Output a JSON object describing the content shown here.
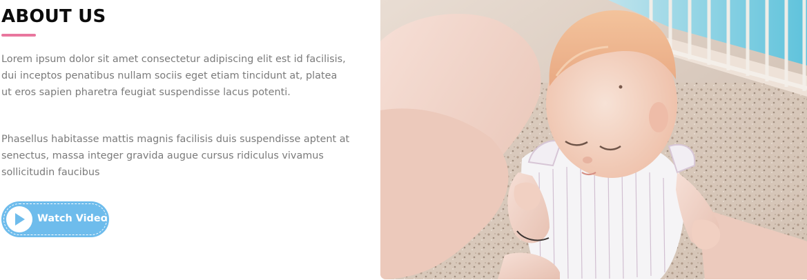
{
  "about": {
    "title": "ABOUT US",
    "paragraph_1": "Lorem ipsum dolor sit amet consectetur adipiscing elit est id facilisis, dui inceptos penatibus nullam sociis eget etiam tincidunt at, platea ut eros sapien pharetra feugiat suspendisse lacus potenti.",
    "paragraph_2": "Phasellus habitasse mattis magnis facilisis duis suspendisse aptent at senectus, massa integer gravida augue cursus ridiculus vivamus sollicitudin faucibus",
    "button": {
      "label": "Watch Video",
      "icon": "play-icon"
    }
  },
  "colors": {
    "accent_pink": "#e9779e",
    "button_blue": "#6ebcec",
    "title": "#0c0c0c",
    "body_text": "#7a7a7a"
  },
  "photo": {
    "icon": "baby-photo"
  }
}
